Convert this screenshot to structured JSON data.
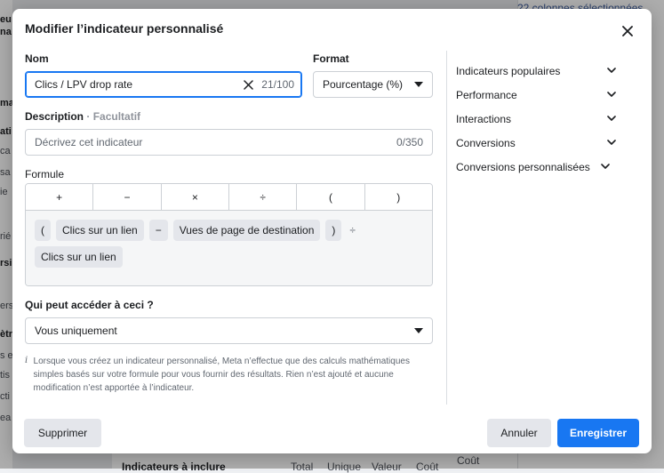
{
  "background": {
    "left_texts": [
      {
        "text": "eu",
        "bold": true
      },
      {
        "text": "na",
        "bold": true
      },
      {
        "text": "ma",
        "bold": true
      },
      {
        "text": "ati",
        "bold": true
      },
      {
        "text": "ca",
        "bold": false
      },
      {
        "text": "sa",
        "bold": false
      },
      {
        "text": "ie",
        "bold": false
      },
      {
        "text": "rié",
        "bold": false
      },
      {
        "text": "rsi",
        "bold": true
      },
      {
        "text": "ers",
        "bold": false
      },
      {
        "text": "ètr",
        "bold": true
      },
      {
        "text": "s e",
        "bold": false
      },
      {
        "text": "tis",
        "bold": false
      },
      {
        "text": "cti",
        "bold": false
      },
      {
        "text": "ea",
        "bold": false
      }
    ],
    "right_top": "22 colonnes sélectionnées",
    "bottom_title": "Indicateurs à inclure",
    "bottom_cols": [
      "Total",
      "Unique",
      "Valeur",
      "Coût"
    ],
    "bottom_extra": "Coût"
  },
  "modal": {
    "title": "Modifier l’indicateur personnalisé",
    "name": {
      "label": "Nom",
      "value": "Clics / LPV drop rate",
      "counter": "21/100"
    },
    "format": {
      "label": "Format",
      "value": "Pourcentage (%)"
    },
    "description": {
      "label": "Description",
      "optional": "· Facultatif",
      "placeholder": "Décrivez cet indicateur",
      "counter": "0/350"
    },
    "formula": {
      "label": "Formule",
      "operators": [
        "+",
        "−",
        "×",
        "÷",
        "(",
        ")"
      ],
      "tokens": [
        {
          "text": "(",
          "kind": "op"
        },
        {
          "text": "Clics sur un lien",
          "kind": "metric"
        },
        {
          "text": "−",
          "kind": "op"
        },
        {
          "text": "Vues de page de destination",
          "kind": "metric"
        },
        {
          "text": ")",
          "kind": "op"
        },
        {
          "text": "÷",
          "kind": "plain"
        },
        {
          "text": "Clics sur un lien",
          "kind": "metric"
        }
      ]
    },
    "access": {
      "label": "Qui peut accéder à ceci ?",
      "value": "Vous uniquement"
    },
    "info_icon": "i",
    "info_text": "Lorsque vous créez un indicateur personnalisé, Meta n’effectue que des calculs mathématiques simples basés sur votre formule pour vous fournir des résultats. Rien n’est ajouté et aucune modification n’est apportée à l’indicateur.",
    "sidebar": [
      "Indicateurs populaires",
      "Performance",
      "Interactions",
      "Conversions",
      "Conversions personnalisées"
    ],
    "buttons": {
      "delete": "Supprimer",
      "cancel": "Annuler",
      "save": "Enregistrer"
    }
  },
  "colors": {
    "primary": "#1877f2",
    "text": "#1c1e21",
    "muted": "#606770",
    "border": "#ccd0d5"
  }
}
